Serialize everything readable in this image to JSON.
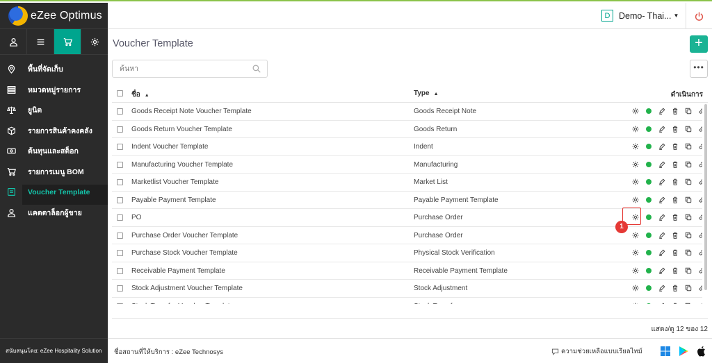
{
  "app": {
    "logo_text": "eZee Optimus"
  },
  "sidebar": {
    "tabs": [
      {
        "icon": "user-icon"
      },
      {
        "icon": "list-icon"
      },
      {
        "icon": "cart-icon",
        "active": true
      },
      {
        "icon": "gear-icon"
      }
    ],
    "items": [
      {
        "label": "พื้นที่จัดเก็บ",
        "icon": "location-pin-icon"
      },
      {
        "label": "หมวดหมู่รายการ",
        "icon": "category-list-icon"
      },
      {
        "label": "ยูนิต",
        "icon": "scale-icon"
      },
      {
        "label": "รายการสินค้าคงคลัง",
        "icon": "box-icon"
      },
      {
        "label": "ต้นทุนและสต็อก",
        "icon": "money-icon"
      },
      {
        "label": "รายการเมนู BOM",
        "icon": "cart-icon"
      },
      {
        "label": "Voucher Template",
        "icon": "template-icon",
        "active": true
      },
      {
        "label": "แคตตาล็อกผู้ขาย",
        "icon": "vendor-icon"
      }
    ],
    "footer": "สนับสนุนโดย: eZee Hospitality Solution"
  },
  "header": {
    "property_badge": "D",
    "property_name": "Demo- Thai...",
    "accent_color": "#00a58e"
  },
  "page": {
    "title": "Voucher Template",
    "add_label": "+",
    "more_label": "•••",
    "search_placeholder": "ค้นหา"
  },
  "table": {
    "columns": {
      "name": "ชื่อ",
      "type": "Type",
      "actions": "ดำเนินการ"
    },
    "rows": [
      {
        "name": "Goods Receipt Note Voucher Template",
        "type": "Goods Receipt Note"
      },
      {
        "name": "Goods Return Voucher Template",
        "type": "Goods Return"
      },
      {
        "name": "Indent Voucher Template",
        "type": "Indent"
      },
      {
        "name": "Manufacturing Voucher Template",
        "type": "Manufacturing"
      },
      {
        "name": "Marketlist Voucher Template",
        "type": "Market List"
      },
      {
        "name": "Payable Payment Template",
        "type": "Payable Payment Template"
      },
      {
        "name": "PO",
        "type": "Purchase Order"
      },
      {
        "name": "Purchase Order Voucher Template",
        "type": "Purchase Order"
      },
      {
        "name": "Purchase Stock Voucher Template",
        "type": "Physical Stock Verification"
      },
      {
        "name": "Receivable Payment Template",
        "type": "Receivable Payment Template"
      },
      {
        "name": "Stock Adjustment Voucher Template",
        "type": "Stock Adjustment"
      },
      {
        "name": "Stock Transfer Voucher Template",
        "type": "Stock Transfer"
      }
    ],
    "status_color": "#21b24b",
    "pager": "แสดง/ดู 12 ของ 12"
  },
  "annotation": {
    "step": "1"
  },
  "footer": {
    "provider": "ชื่อสถานที่ให้บริการ : eZee Technosys",
    "help": "ความช่วยเหลือแบบเรียลไทม์"
  }
}
